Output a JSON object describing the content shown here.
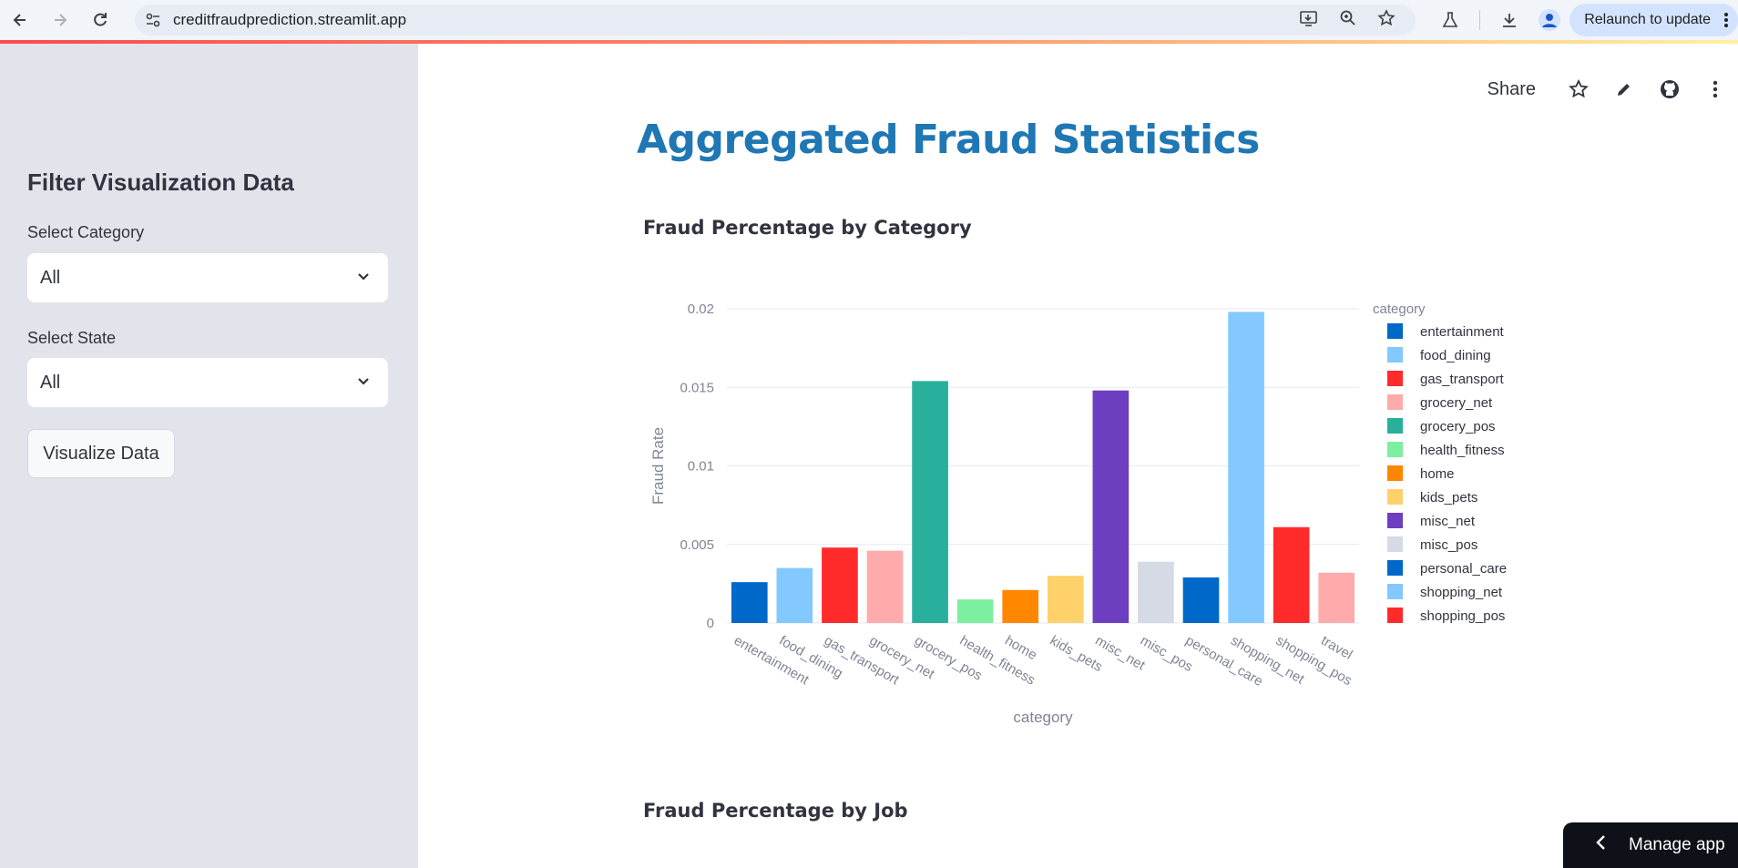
{
  "browser": {
    "url": "creditfraudprediction.streamlit.app",
    "relaunch_label": "Relaunch to update",
    "icons": [
      "back-icon",
      "forward-icon",
      "reload-icon",
      "site-settings-icon",
      "install-icon",
      "zoom-icon",
      "bookmark-star-icon",
      "labs-flask-icon",
      "download-icon",
      "profile-icon",
      "more-vert-icon"
    ]
  },
  "sidebar": {
    "title": "Filter Visualization Data",
    "category_label": "Select Category",
    "category_value": "All",
    "state_label": "Select State",
    "state_value": "All",
    "button_label": "Visualize Data"
  },
  "header": {
    "share_label": "Share",
    "icons": [
      "star-icon",
      "edit-pencil-icon",
      "github-icon",
      "more-vert-icon"
    ]
  },
  "main": {
    "title": "Aggregated Fraud Statistics",
    "section1_title": "Fraud Percentage by Category",
    "section2_title": "Fraud Percentage by Job"
  },
  "manage_label": "Manage app",
  "chart_data": {
    "type": "bar",
    "categories": [
      "entertainment",
      "food_dining",
      "gas_transport",
      "grocery_net",
      "grocery_pos",
      "health_fitness",
      "home",
      "kids_pets",
      "misc_net",
      "misc_pos",
      "personal_care",
      "shopping_net",
      "shopping_pos",
      "travel"
    ],
    "values": [
      0.0026,
      0.0035,
      0.0048,
      0.0046,
      0.0154,
      0.0015,
      0.0021,
      0.003,
      0.0148,
      0.0039,
      0.0029,
      0.0198,
      0.0061,
      0.0032
    ],
    "colors": [
      "#0068c9",
      "#83c9ff",
      "#ff2b2b",
      "#ffabab",
      "#29b09d",
      "#7defa1",
      "#ff8700",
      "#ffd16a",
      "#6d3fc0",
      "#d5dae5",
      "#0068c9",
      "#83c9ff",
      "#ff2b2b",
      "#ffabab"
    ],
    "xlabel": "category",
    "ylabel": "Fraud Rate",
    "ylim": [
      0,
      0.02
    ],
    "yticks": [
      0,
      0.005,
      0.01,
      0.015,
      0.02
    ],
    "ytick_labels": [
      "0",
      "0.005",
      "0.01",
      "0.015",
      "0.02"
    ],
    "legend_title": "category",
    "legend_entries": [
      "entertainment",
      "food_dining",
      "gas_transport",
      "grocery_net",
      "grocery_pos",
      "health_fitness",
      "home",
      "kids_pets",
      "misc_net",
      "misc_pos",
      "personal_care",
      "shopping_net",
      "shopping_pos"
    ],
    "grid": true,
    "legend_position": "right"
  }
}
